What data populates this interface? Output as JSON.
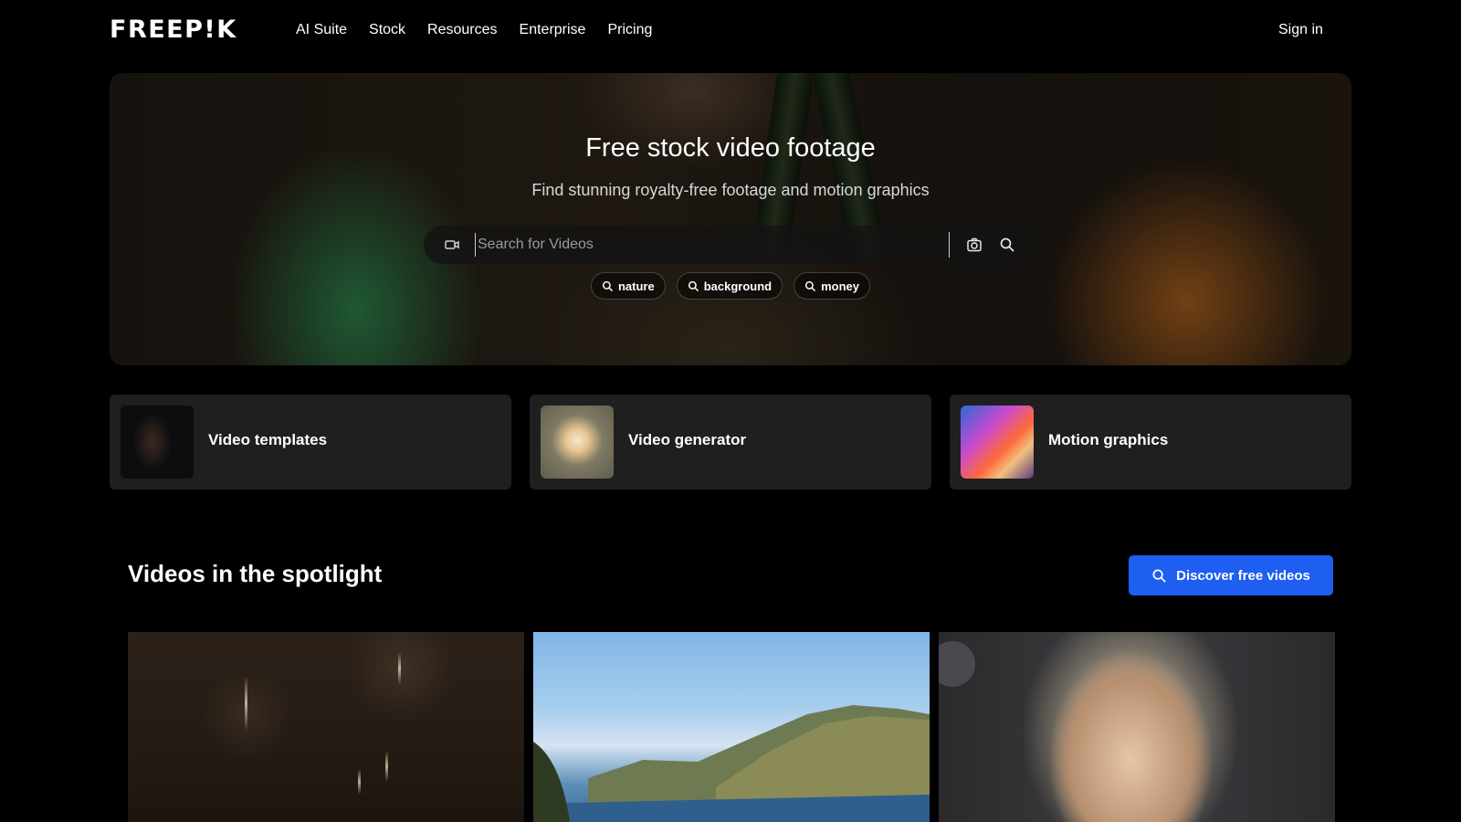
{
  "header": {
    "logo": "FREEP!K",
    "nav": [
      "AI Suite",
      "Stock",
      "Resources",
      "Enterprise",
      "Pricing"
    ],
    "sign_in": "Sign in"
  },
  "hero": {
    "title": "Free stock video footage",
    "subtitle": "Find stunning royalty-free footage and motion graphics",
    "search": {
      "placeholder": "Search for Videos",
      "type_icon": "video-camera-icon",
      "image_search_icon": "camera-icon",
      "submit_icon": "search-icon"
    },
    "chips": [
      "nature",
      "background",
      "money"
    ]
  },
  "categories": [
    {
      "label": "Video templates"
    },
    {
      "label": "Video generator"
    },
    {
      "label": "Motion graphics"
    }
  ],
  "spotlight": {
    "title": "Videos in the spotlight",
    "button": "Discover free videos",
    "button_color": "#1e5ef0"
  },
  "colors": {
    "background": "#000000",
    "card": "#1f1f1f",
    "accent": "#1e5ef0"
  }
}
